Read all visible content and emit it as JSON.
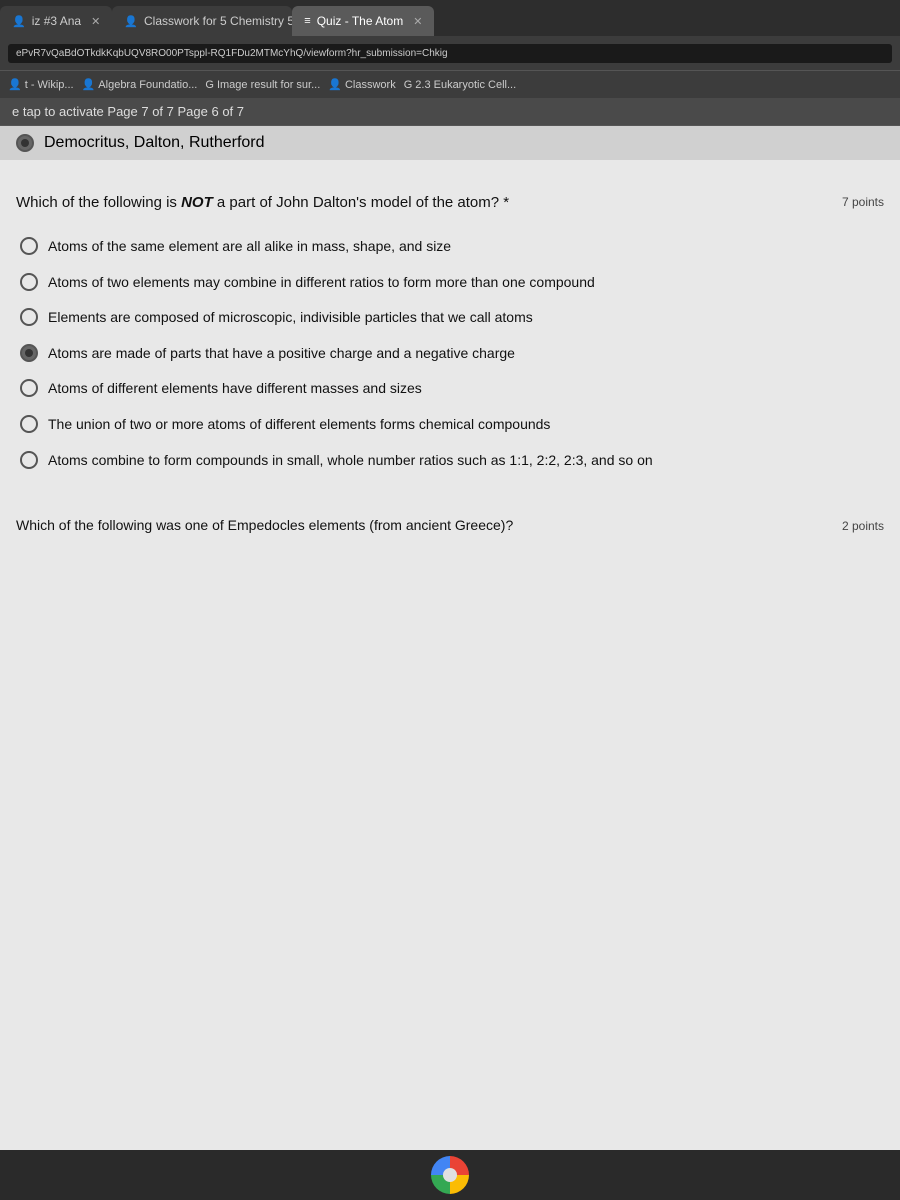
{
  "browser": {
    "page_indicator": "e tap to activate  Page 7 of 7  Page 6 of 7",
    "tabs": [
      {
        "id": "tab1",
        "label": "iz #3 Ana",
        "icon": "👤",
        "active": false
      },
      {
        "id": "tab2",
        "label": "Classwork for 5 Chemistry 5",
        "icon": "👤",
        "active": false
      },
      {
        "id": "tab3",
        "label": "Quiz - The Atom",
        "icon": "≡",
        "active": true
      }
    ],
    "url": "ePvR7vQaBdOTkdkKqbUQV8RO00PTsppl-RQ1FDu2MTMcYhQ/viewform?hr_submission=Chkig",
    "bookmarks": [
      {
        "label": "t - Wikip...",
        "icon": "👤"
      },
      {
        "label": "Algebra Foundatio...",
        "icon": "👤"
      },
      {
        "label": "Image result for sur...",
        "icon": "G"
      },
      {
        "label": "Classwork",
        "icon": "👤"
      },
      {
        "label": "2.3 Eukaryotic Cell...",
        "icon": "G"
      }
    ]
  },
  "page": {
    "previous_answer": "Democritus, Dalton, Rutherford",
    "question": {
      "text": "Which of the following is NOT a part of John Dalton's model of the atom?",
      "not_word": "NOT",
      "points": "7 points",
      "options": [
        {
          "id": "opt1",
          "text": "Atoms of the same element are all alike in mass, shape, and size",
          "selected": false
        },
        {
          "id": "opt2",
          "text": "Atoms of two elements may combine in different ratios to form more than one compound",
          "selected": false
        },
        {
          "id": "opt3",
          "text": "Elements are composed of microscopic, indivisible particles that we call atoms",
          "selected": false
        },
        {
          "id": "opt4",
          "text": "Atoms are made of parts that have a positive charge and a negative charge",
          "selected": true
        },
        {
          "id": "opt5",
          "text": "Atoms of different elements have different masses and sizes",
          "selected": false
        },
        {
          "id": "opt6",
          "text": "The union of two or more atoms of different elements forms chemical compounds",
          "selected": false
        },
        {
          "id": "opt7",
          "text": "Atoms combine to form compounds in small, whole number ratios such as 1:1, 2:2, 2:3, and so on",
          "selected": false
        }
      ]
    },
    "next_question": {
      "text": "Which of the following was one of Empedocles elements (from ancient Greece)?",
      "points": "2 points"
    }
  }
}
